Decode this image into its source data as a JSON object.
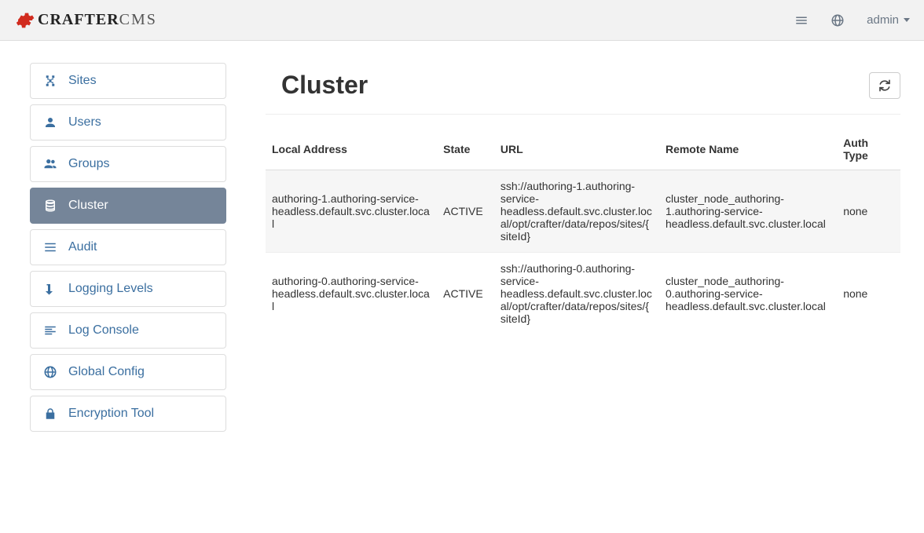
{
  "header": {
    "brand_bold": "CRAFTER",
    "brand_thin": "CMS",
    "user_label": "admin"
  },
  "sidebar": {
    "items": [
      {
        "label": "Sites",
        "icon": "sitemap",
        "active": false
      },
      {
        "label": "Users",
        "icon": "user",
        "active": false
      },
      {
        "label": "Groups",
        "icon": "users",
        "active": false
      },
      {
        "label": "Cluster",
        "icon": "database",
        "active": true
      },
      {
        "label": "Audit",
        "icon": "list",
        "active": false
      },
      {
        "label": "Logging Levels",
        "icon": "level-down",
        "active": false
      },
      {
        "label": "Log Console",
        "icon": "align-left",
        "active": false
      },
      {
        "label": "Global Config",
        "icon": "globe",
        "active": false
      },
      {
        "label": "Encryption Tool",
        "icon": "lock",
        "active": false
      }
    ]
  },
  "page": {
    "title": "Cluster"
  },
  "table": {
    "columns": [
      "Local Address",
      "State",
      "URL",
      "Remote Name",
      "Auth Type"
    ],
    "rows": [
      {
        "local_address": "authoring-1.authoring-service-headless.default.svc.cluster.local",
        "state": "ACTIVE",
        "url": "ssh://authoring-1.authoring-service-headless.default.svc.cluster.local/opt/crafter/data/repos/sites/{siteId}",
        "remote_name": "cluster_node_authoring-1.authoring-service-headless.default.svc.cluster.local",
        "auth_type": "none"
      },
      {
        "local_address": "authoring-0.authoring-service-headless.default.svc.cluster.local",
        "state": "ACTIVE",
        "url": "ssh://authoring-0.authoring-service-headless.default.svc.cluster.local/opt/crafter/data/repos/sites/{siteId}",
        "remote_name": "cluster_node_authoring-0.authoring-service-headless.default.svc.cluster.local",
        "auth_type": "none"
      }
    ]
  }
}
